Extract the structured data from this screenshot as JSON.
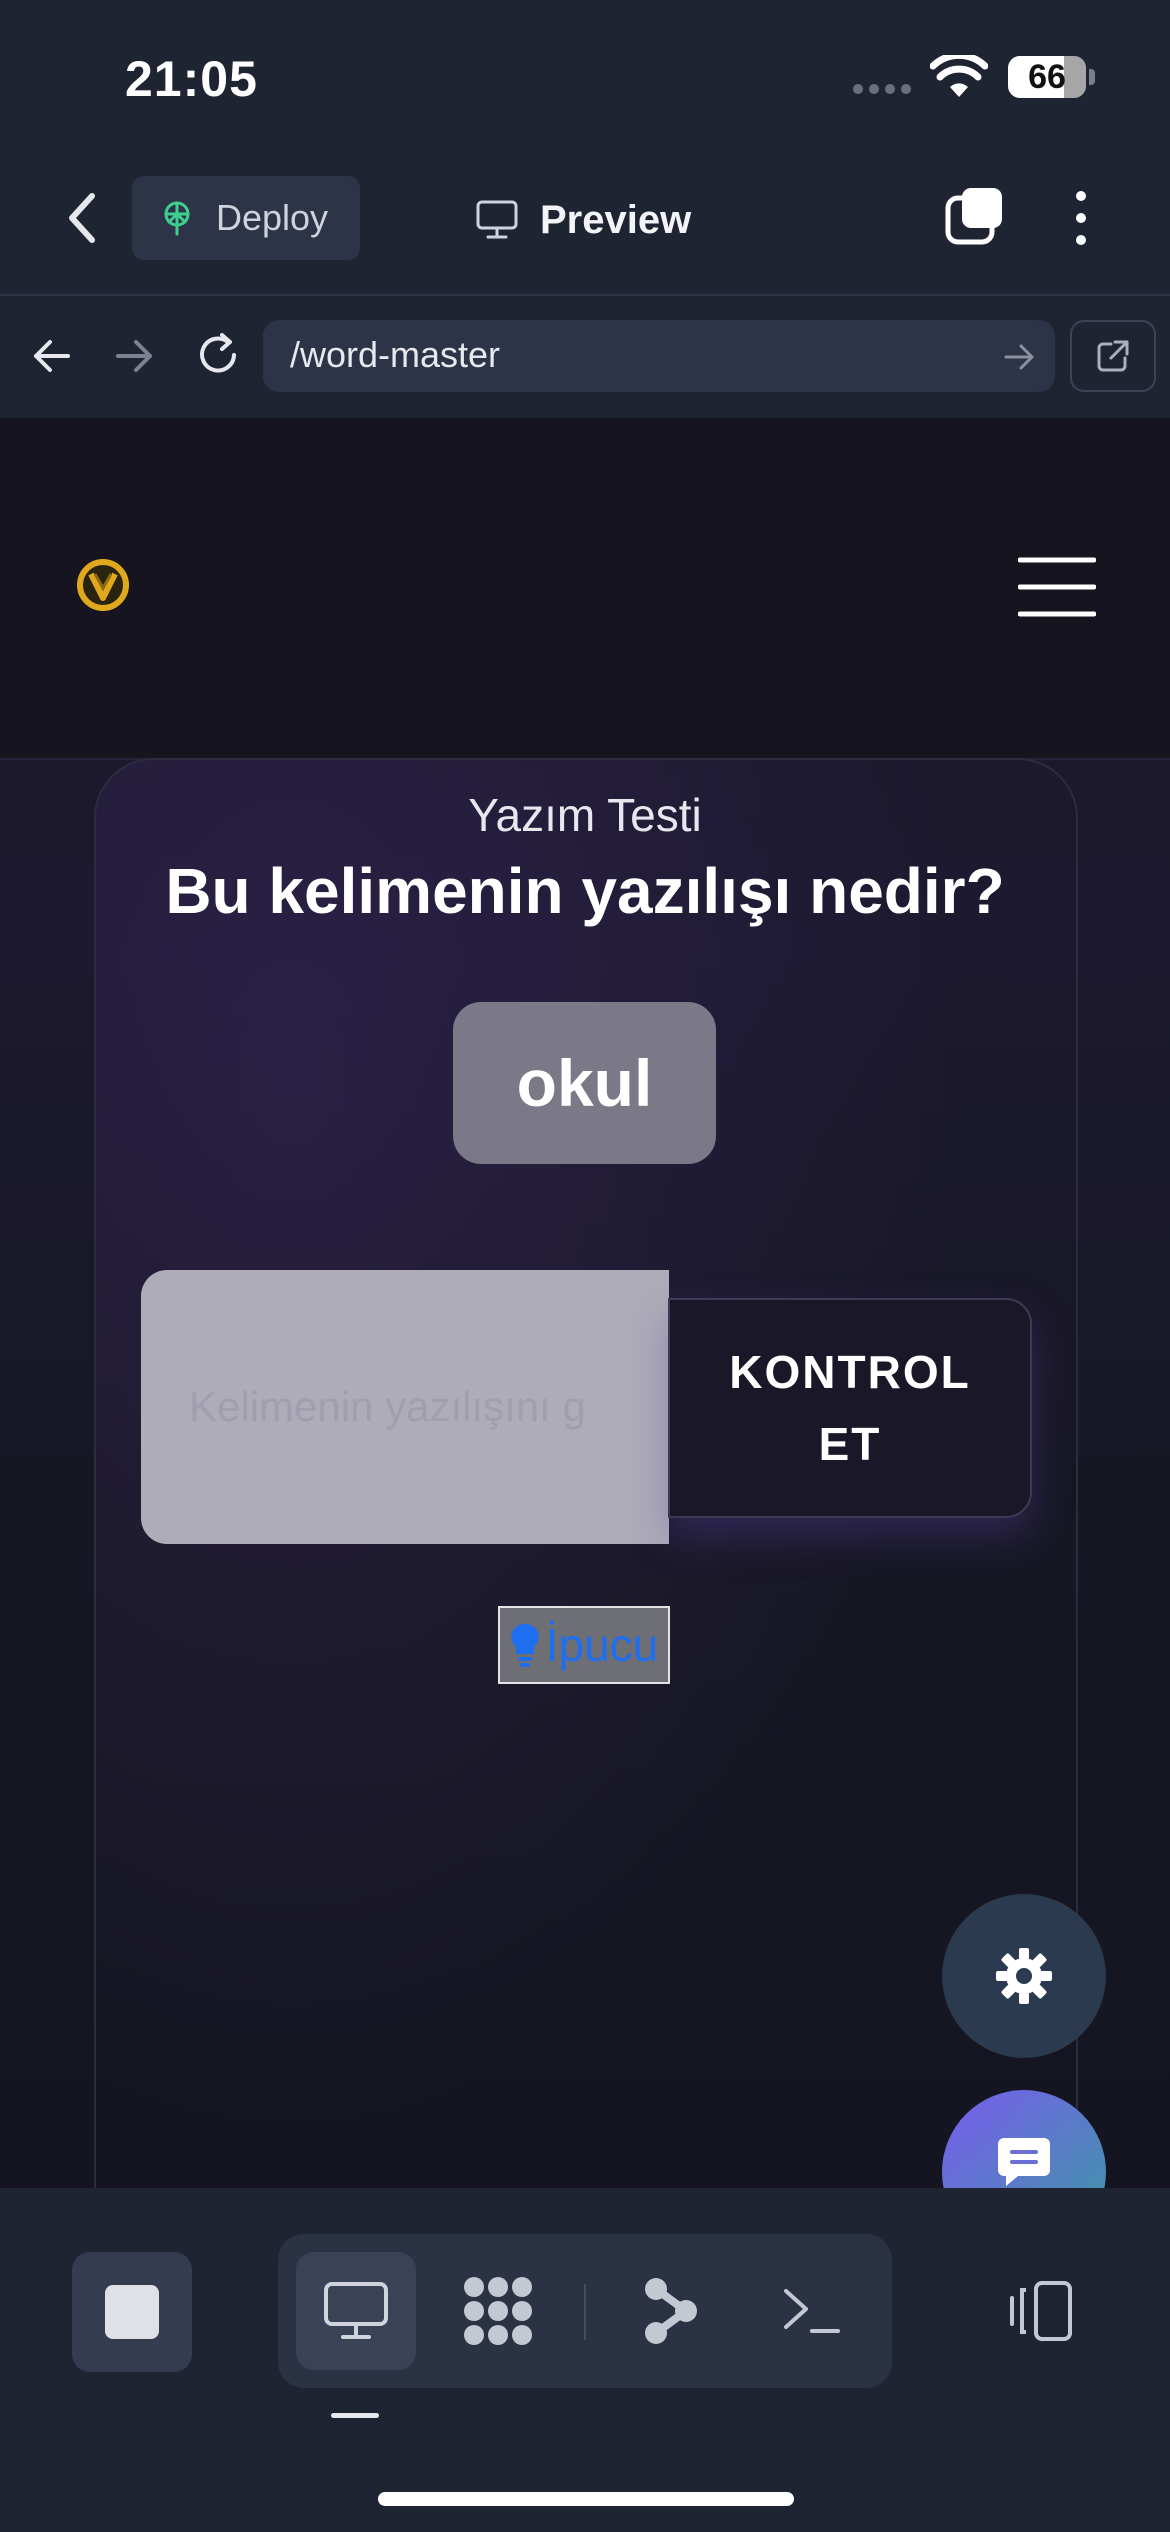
{
  "status_bar": {
    "time": "21:05",
    "battery": "66",
    "icons": [
      "signal-dots-icon",
      "wifi-icon",
      "battery-icon"
    ]
  },
  "app_header": {
    "deploy_label": "Deploy",
    "preview_label": "Preview",
    "icons": [
      "chevron-left-icon",
      "deploy-icon",
      "monitor-icon",
      "tabs-icon",
      "more-vertical-icon"
    ]
  },
  "url_bar": {
    "url": "/word-master",
    "icons": [
      "arrow-left-icon",
      "arrow-right-icon",
      "reload-icon",
      "go-arrow-icon",
      "external-link-icon"
    ]
  },
  "page": {
    "quiz_type": "Yazım Testi",
    "question": "Bu kelimenin yazılışı nedir?",
    "word": "okul",
    "input_placeholder": "Kelimenin yazılışını g",
    "check_button_label": "KONTROL ET",
    "hint_label": "İpucu",
    "icons": [
      "logo-icon",
      "hamburger-menu-icon",
      "lightbulb-icon",
      "gear-icon",
      "chat-icon"
    ]
  },
  "bottom_toolbar": {
    "icons": [
      "stop-icon",
      "monitor-icon",
      "nodes-icon",
      "git-branch-icon",
      "terminal-icon",
      "layout-toggle-icon"
    ]
  },
  "colors": {
    "background": "#1f2433",
    "accent_green": "#3ecf8e",
    "hint_blue": "#1e6ef0",
    "logo_gold": "#e0a81c"
  }
}
